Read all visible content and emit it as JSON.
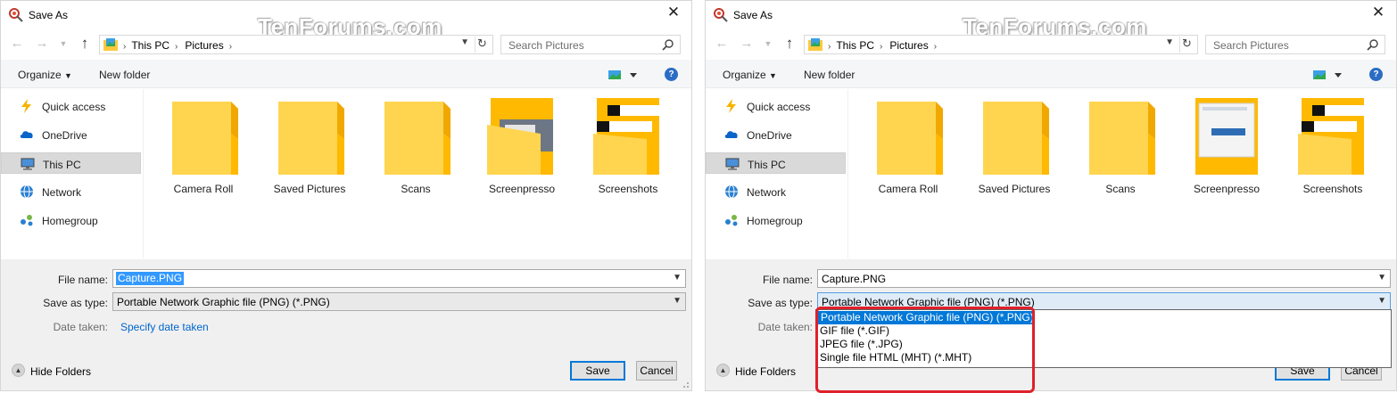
{
  "site_watermark": "TenForums.com",
  "dialogs": [
    {
      "title": "Save As",
      "address": {
        "crumbs": [
          "This PC",
          "Pictures"
        ]
      },
      "search": {
        "placeholder": "Search Pictures"
      },
      "toolbar": {
        "organize": "Organize",
        "new_folder": "New folder",
        "help": "?"
      },
      "nav": [
        {
          "label": "Quick access",
          "icon": "lightning-icon"
        },
        {
          "label": "OneDrive",
          "icon": "cloud-icon"
        },
        {
          "label": "This PC",
          "icon": "computer-icon",
          "selected": true
        },
        {
          "label": "Network",
          "icon": "network-icon"
        },
        {
          "label": "Homegroup",
          "icon": "homegroup-icon"
        }
      ],
      "folders": [
        "Camera Roll",
        "Saved Pictures",
        "Scans",
        "Screenpresso",
        "Screenshots"
      ],
      "form": {
        "file_name_label": "File name:",
        "file_name_value": "Capture.PNG",
        "save_type_label": "Save as type:",
        "save_type_value": "Portable Network Graphic file (PNG) (*.PNG)",
        "date_label": "Date taken:",
        "date_link": "Specify date taken"
      },
      "hide_folders": "Hide Folders",
      "save_button": "Save",
      "cancel_button": "Cancel"
    },
    {
      "title": "Save As",
      "address": {
        "crumbs": [
          "This PC",
          "Pictures"
        ]
      },
      "search": {
        "placeholder": "Search Pictures"
      },
      "toolbar": {
        "organize": "Organize",
        "new_folder": "New folder",
        "help": "?"
      },
      "nav": [
        {
          "label": "Quick access",
          "icon": "lightning-icon"
        },
        {
          "label": "OneDrive",
          "icon": "cloud-icon"
        },
        {
          "label": "This PC",
          "icon": "computer-icon",
          "selected": true
        },
        {
          "label": "Network",
          "icon": "network-icon"
        },
        {
          "label": "Homegroup",
          "icon": "homegroup-icon"
        }
      ],
      "folders": [
        "Camera Roll",
        "Saved Pictures",
        "Scans",
        "Screenpresso",
        "Screenshots"
      ],
      "form": {
        "file_name_label": "File name:",
        "file_name_value": "Capture.PNG",
        "save_type_label": "Save as type:",
        "save_type_value": "Portable Network Graphic file (PNG) (*.PNG)",
        "date_label": "Date taken:",
        "date_link": ""
      },
      "hide_folders": "Hide Folders",
      "save_button": "Save",
      "cancel_button": "Cancel",
      "type_options": [
        "Portable Network Graphic file (PNG) (*.PNG)",
        "GIF file (*.GIF)",
        "JPEG file (*.JPG)",
        "Single file HTML (MHT) (*.MHT)"
      ]
    }
  ],
  "colors": {
    "accent": "#0078d7",
    "highlight_box": "#e0202a",
    "folder_yellow": "#ffd54f",
    "folder_tab": "#ffb900",
    "link": "#0066cc"
  }
}
